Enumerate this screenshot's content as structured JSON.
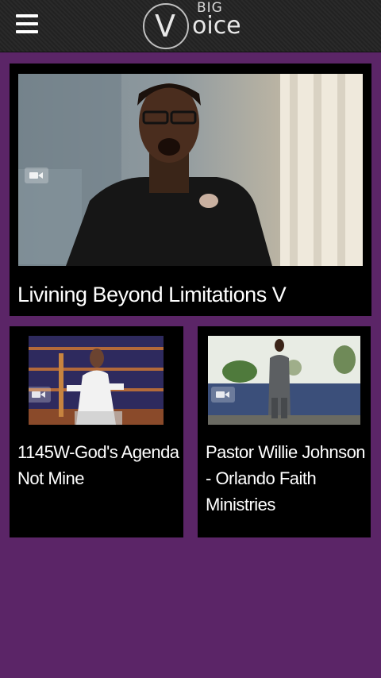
{
  "header": {
    "menu_icon": "hamburger-menu-icon",
    "logo": {
      "letter": "V",
      "top": "BIG",
      "rest": "oice"
    }
  },
  "videos": [
    {
      "title": "Livining Beyond Limitations V",
      "icon": "video-camera-icon"
    },
    {
      "title": "1145W-God's Agenda Not Mine",
      "icon": "video-camera-icon"
    },
    {
      "title": "Pastor Willie Johnson - Orlando Faith Ministries",
      "icon": "video-camera-icon"
    }
  ],
  "colors": {
    "background": "#5b2567",
    "card": "#000000",
    "header": "#262626"
  }
}
